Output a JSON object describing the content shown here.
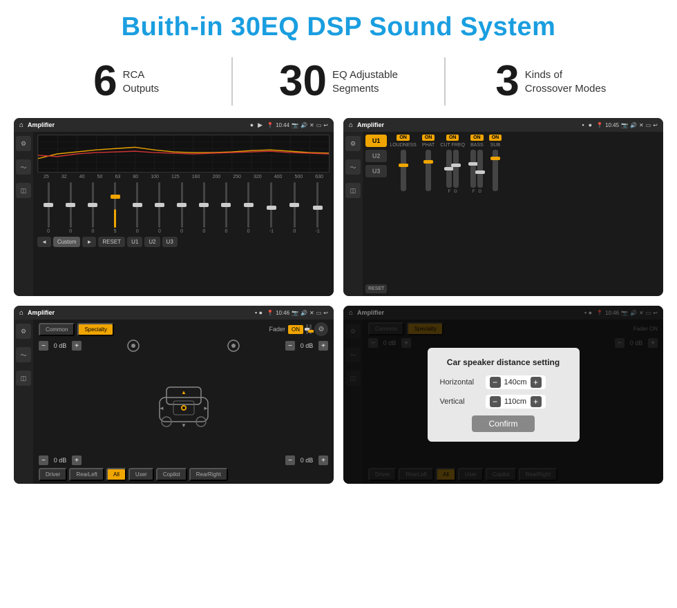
{
  "page": {
    "title": "Buith-in 30EQ DSP Sound System"
  },
  "stats": [
    {
      "number": "6",
      "label": "RCA\nOutputs"
    },
    {
      "number": "30",
      "label": "EQ Adjustable\nSegments"
    },
    {
      "number": "3",
      "label": "Kinds of\nCrossover Modes"
    }
  ],
  "screens": {
    "eq": {
      "app_name": "Amplifier",
      "time": "10:44",
      "freq_labels": [
        "25",
        "32",
        "40",
        "50",
        "63",
        "80",
        "100",
        "125",
        "160",
        "200",
        "250",
        "320",
        "400",
        "500",
        "630"
      ],
      "slider_values": [
        "0",
        "0",
        "0",
        "5",
        "0",
        "0",
        "0",
        "0",
        "0",
        "0",
        "-1",
        "0",
        "-1"
      ],
      "preset": "Custom",
      "buttons": [
        "RESET",
        "U1",
        "U2",
        "U3"
      ]
    },
    "crossover": {
      "app_name": "Amplifier",
      "time": "10:45",
      "presets": [
        "U1",
        "U2",
        "U3"
      ],
      "channels": [
        {
          "name": "LOUDNESS",
          "on": true
        },
        {
          "name": "PHAT",
          "on": true
        },
        {
          "name": "CUT FREQ",
          "on": true
        },
        {
          "name": "BASS",
          "on": true
        },
        {
          "name": "SUB",
          "on": true
        }
      ],
      "reset_label": "RESET"
    },
    "fader": {
      "app_name": "Amplifier",
      "time": "10:46",
      "tabs": [
        "Common",
        "Specialty"
      ],
      "fader_label": "Fader",
      "fader_on": "ON",
      "db_values": [
        "0 dB",
        "0 dB",
        "0 dB",
        "0 dB"
      ],
      "footer_btns": [
        "Driver",
        "RearLeft",
        "All",
        "User",
        "Copilot",
        "RearRight"
      ]
    },
    "distance": {
      "app_name": "Amplifier",
      "time": "10:46",
      "tabs": [
        "Common",
        "Specialty"
      ],
      "dialog": {
        "title": "Car speaker distance setting",
        "horizontal_label": "Horizontal",
        "horizontal_value": "140cm",
        "vertical_label": "Vertical",
        "vertical_value": "110cm",
        "confirm_label": "Confirm"
      },
      "db_values": [
        "0 dB",
        "0 dB"
      ],
      "footer_btns": [
        "Driver",
        "RearLeft",
        "All",
        "User",
        "Copilot",
        "RearRight"
      ]
    }
  }
}
